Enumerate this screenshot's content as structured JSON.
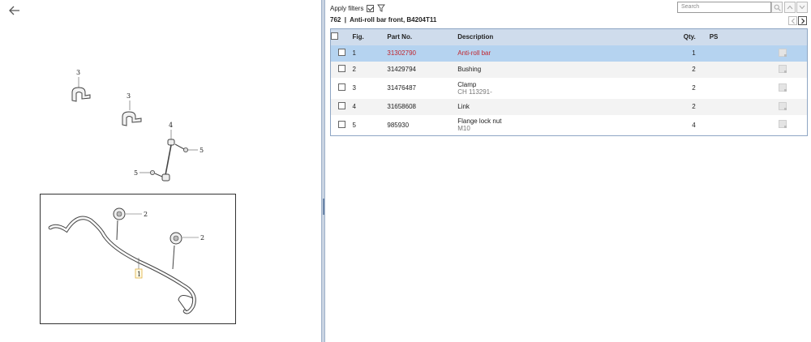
{
  "nav": {
    "back_icon": "arrow-left-icon"
  },
  "diagram": {
    "callouts": [
      {
        "label": "3"
      },
      {
        "label": "3"
      },
      {
        "label": "4"
      },
      {
        "label": "5"
      },
      {
        "label": "5"
      },
      {
        "label": "2"
      },
      {
        "label": "2"
      },
      {
        "label": "1"
      }
    ]
  },
  "toolbar": {
    "apply_filters_label": "Apply filters",
    "apply_filters_checked": true,
    "filter_icon": "funnel-icon",
    "search_placeholder": "Search",
    "search_icon": "magnifier-icon",
    "up_icon": "chevron-up-icon",
    "down_icon": "chevron-down-icon"
  },
  "group": {
    "title": "762  |  Anti-roll bar front, B4204T11",
    "prev_icon": "chevron-left-icon",
    "next_icon": "chevron-right-icon"
  },
  "table": {
    "headers": {
      "fig": "Fig.",
      "part_no": "Part No.",
      "description": "Description",
      "qty": "Qty.",
      "ps": "PS"
    },
    "rows": [
      {
        "fig": "1",
        "part_no": "31302790",
        "description": "Anti-roll bar",
        "sub": "",
        "qty": "1",
        "selected": true
      },
      {
        "fig": "2",
        "part_no": "31429794",
        "description": "Bushing",
        "sub": "",
        "qty": "2",
        "selected": false
      },
      {
        "fig": "3",
        "part_no": "31476487",
        "description": "Clamp",
        "sub": "CH 113291-",
        "qty": "2",
        "selected": false
      },
      {
        "fig": "4",
        "part_no": "31658608",
        "description": "Link",
        "sub": "",
        "qty": "2",
        "selected": false
      },
      {
        "fig": "5",
        "part_no": "985930",
        "description": "Flange lock nut",
        "sub": "M10",
        "qty": "4",
        "selected": false
      }
    ]
  },
  "colors": {
    "selected_row": "#b5d3f0",
    "selected_text": "#c0262f",
    "header_bg": "#cfdcec",
    "splitter": "#c9d4e2"
  }
}
